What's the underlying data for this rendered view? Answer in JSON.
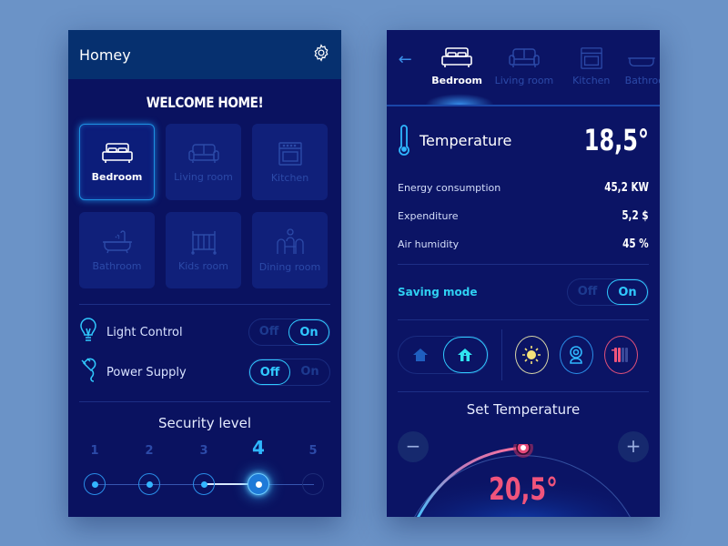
{
  "left": {
    "app_title": "Homey",
    "welcome": "WELCOME HOME!",
    "rooms": [
      {
        "label": "Bedroom",
        "icon": "bed-icon",
        "active": true
      },
      {
        "label": "Living room",
        "icon": "sofa-icon",
        "active": false
      },
      {
        "label": "Kitchen",
        "icon": "oven-icon",
        "active": false
      },
      {
        "label": "Bathroom",
        "icon": "bathtub-icon",
        "active": false
      },
      {
        "label": "Kids room",
        "icon": "crib-icon",
        "active": false
      },
      {
        "label": "Dining room",
        "icon": "dining-icon",
        "active": false
      }
    ],
    "controls": [
      {
        "label": "Light Control",
        "off": "Off",
        "on": "On",
        "state": "on"
      },
      {
        "label": "Power Supply",
        "off": "Off",
        "on": "On",
        "state": "off"
      }
    ],
    "security": {
      "title": "Security level",
      "levels": [
        "1",
        "2",
        "3",
        "4",
        "5"
      ],
      "current": 4
    }
  },
  "right": {
    "tabs": [
      {
        "label": "Bedroom",
        "active": true
      },
      {
        "label": "Living room",
        "active": false
      },
      {
        "label": "Kitchen",
        "active": false
      },
      {
        "label": "Bathroom",
        "active": false
      }
    ],
    "temperature": {
      "label": "Temperature",
      "value": "18,5°"
    },
    "stats": [
      {
        "label": "Energy consumption",
        "value": "45,2 KW"
      },
      {
        "label": "Expenditure",
        "value": "5,2 $"
      },
      {
        "label": "Air humidity",
        "value": "45 %"
      }
    ],
    "saving_mode": {
      "label": "Saving mode",
      "off": "Off",
      "on": "On",
      "state": "on"
    },
    "set_temperature": {
      "title": "Set Temperature",
      "value": "20,5°",
      "minus": "−",
      "plus": "+",
      "fraction": 0.5
    },
    "colors": {
      "accent": "#30c9ff",
      "hot": "#f0547c",
      "sun": "#f5e27a"
    }
  }
}
